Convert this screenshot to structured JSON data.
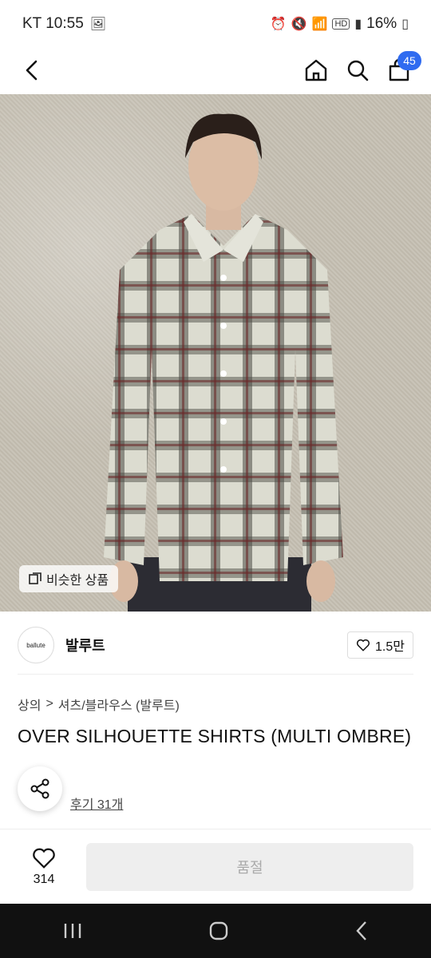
{
  "status": {
    "carrier_time": "KT 10:55",
    "battery": "16%",
    "icons": [
      "gallery-icon",
      "alarm-icon",
      "mute-icon",
      "wifi-icon",
      "hd-icon",
      "signal-icon",
      "battery-icon"
    ]
  },
  "nav": {
    "cart_count": "45",
    "icons": [
      "back-arrow-icon",
      "home-icon",
      "search-icon",
      "cart-icon"
    ]
  },
  "hero": {
    "similar_label": "비슷한 상품"
  },
  "brand": {
    "logo_text": "ballute",
    "name": "발루트",
    "likes": "1.5만"
  },
  "breadcrumb": {
    "category": "상의",
    "separator": ">",
    "subcategory": "셔츠/블라우스 (발루트)"
  },
  "product": {
    "title": "OVER SILHOUETTE SHIRTS (MULTI OMBRE)",
    "reviews": "후기 31개"
  },
  "bottom": {
    "wish_count": "314",
    "buy_label": "품절"
  },
  "colors": {
    "accent": "#2f6bf0",
    "soldout_bg": "#eeeeee",
    "soldout_text": "#aaaaaa"
  }
}
